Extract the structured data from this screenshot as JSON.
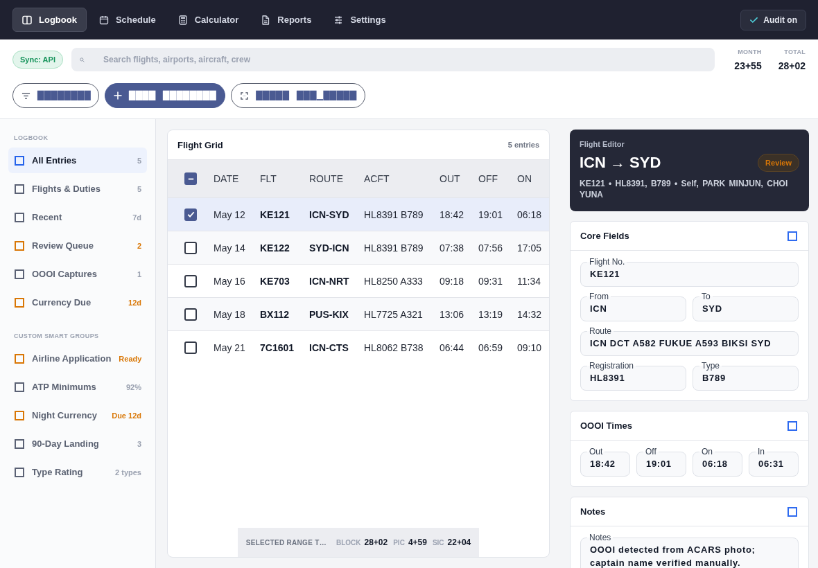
{
  "nav": {
    "tabs": [
      {
        "label": "Logbook",
        "selected": true
      },
      {
        "label": "Schedule",
        "selected": false
      },
      {
        "label": "Calculator",
        "selected": false
      },
      {
        "label": "Reports",
        "selected": false
      },
      {
        "label": "Settings",
        "selected": false
      }
    ],
    "audit_button": {
      "label": "Audit on",
      "on": true
    }
  },
  "toolbar": {
    "sync_badge": "Sync: API",
    "search": {
      "placeholder": "Search flights, airports, aircraft, crew"
    },
    "stats": [
      {
        "label": "MONTH",
        "value": "23+55"
      },
      {
        "label": "TOTAL",
        "value": "28+02"
      }
    ],
    "actions": [
      {
        "kind": "outline",
        "label": "████████"
      },
      {
        "kind": "primary",
        "label": "████ ████████"
      },
      {
        "kind": "outline",
        "label": "█████ ███▁█████"
      }
    ]
  },
  "sidebar": {
    "sections": [
      {
        "heading": "LOGBOOK",
        "items": [
          {
            "label": "All Entries",
            "count": "5",
            "selected": true,
            "alert": false
          },
          {
            "label": "Flights & Duties",
            "count": "5",
            "selected": false,
            "alert": false
          },
          {
            "label": "Recent",
            "count": "7d",
            "selected": false,
            "alert": false
          },
          {
            "label": "Review Queue",
            "count": "2",
            "selected": false,
            "alert": true
          },
          {
            "label": "OOOI Captures",
            "count": "1",
            "selected": false,
            "alert": false
          },
          {
            "label": "Currency Due",
            "count": "12d",
            "selected": false,
            "alert": true
          }
        ]
      },
      {
        "heading": "CUSTOM SMART GROUPS",
        "items": [
          {
            "label": "Airline Application",
            "count": "Ready",
            "selected": false,
            "alert": true
          },
          {
            "label": "ATP Minimums",
            "count": "92%",
            "selected": false,
            "alert": false
          },
          {
            "label": "Night Currency",
            "count": "Due 12d",
            "selected": false,
            "alert": true
          },
          {
            "label": "90-Day Landing",
            "count": "3",
            "selected": false,
            "alert": false
          },
          {
            "label": "Type Rating",
            "count": "2 types",
            "selected": false,
            "alert": false
          }
        ]
      }
    ]
  },
  "grid": {
    "title": "Flight Grid",
    "count": "5 entries",
    "select_all": {
      "partial": true
    },
    "columns": [
      "DATE",
      "FLT",
      "ROUTE",
      "ACFT",
      "OUT",
      "OFF",
      "ON"
    ],
    "rows": [
      {
        "selected": true,
        "cells": [
          "May 12",
          "KE121",
          "ICN-SYD",
          "HL8391 B789",
          "18:42",
          "19:01",
          "06:18"
        ]
      },
      {
        "selected": false,
        "cells": [
          "May 14",
          "KE122",
          "SYD-ICN",
          "HL8391 B789",
          "07:38",
          "07:56",
          "17:05"
        ]
      },
      {
        "selected": false,
        "cells": [
          "May 16",
          "KE703",
          "ICN-NRT",
          "HL8250 A333",
          "09:18",
          "09:31",
          "11:34"
        ]
      },
      {
        "selected": false,
        "cells": [
          "May 18",
          "BX112",
          "PUS-KIX",
          "HL7725 A321",
          "13:06",
          "13:19",
          "14:32"
        ]
      },
      {
        "selected": false,
        "cells": [
          "May 21",
          "7C1601",
          "ICN-CTS",
          "HL8062 B738",
          "06:44",
          "06:59",
          "09:10"
        ]
      }
    ],
    "summary": {
      "label": "SELECTED RANGE T…",
      "totals": [
        {
          "label": "BLOCK",
          "value": "28+02"
        },
        {
          "label": "PIC",
          "value": "4+59"
        },
        {
          "label": "SIC",
          "value": "22+04"
        }
      ]
    }
  },
  "editor": {
    "eyebrow": "Flight Editor",
    "title": "ICN → SYD",
    "status": {
      "label": "Review",
      "kind": "warning"
    },
    "meta": "KE121 • HL8391, B789 • Self, PARK MINJUN, CHOI YUNA",
    "sections": [
      {
        "title": "Core Fields",
        "rows": [
          {
            "fields": [
              {
                "label": "Flight No.",
                "value": "KE121"
              }
            ]
          },
          {
            "fields": [
              {
                "label": "From",
                "value": "ICN"
              },
              {
                "label": "To",
                "value": "SYD"
              }
            ]
          },
          {
            "fields": [
              {
                "label": "Route",
                "value": "ICN DCT A582 FUKUE A593 BIKSI SYD"
              }
            ]
          },
          {
            "fields": [
              {
                "label": "Registration",
                "value": "HL8391"
              },
              {
                "label": "Type",
                "value": "B789"
              }
            ]
          }
        ]
      },
      {
        "title": "OOOI Times",
        "rows": [
          {
            "fields": [
              {
                "label": "Out",
                "value": "18:42"
              },
              {
                "label": "Off",
                "value": "19:01"
              },
              {
                "label": "On",
                "value": "06:18"
              },
              {
                "label": "In",
                "value": "06:31"
              }
            ]
          }
        ]
      },
      {
        "title": "Notes",
        "rows": [
          {
            "fields": [
              {
                "label": "Notes",
                "value": "OOOI detected from ACARS photo; captain name verified manually."
              }
            ]
          }
        ]
      }
    ]
  }
}
